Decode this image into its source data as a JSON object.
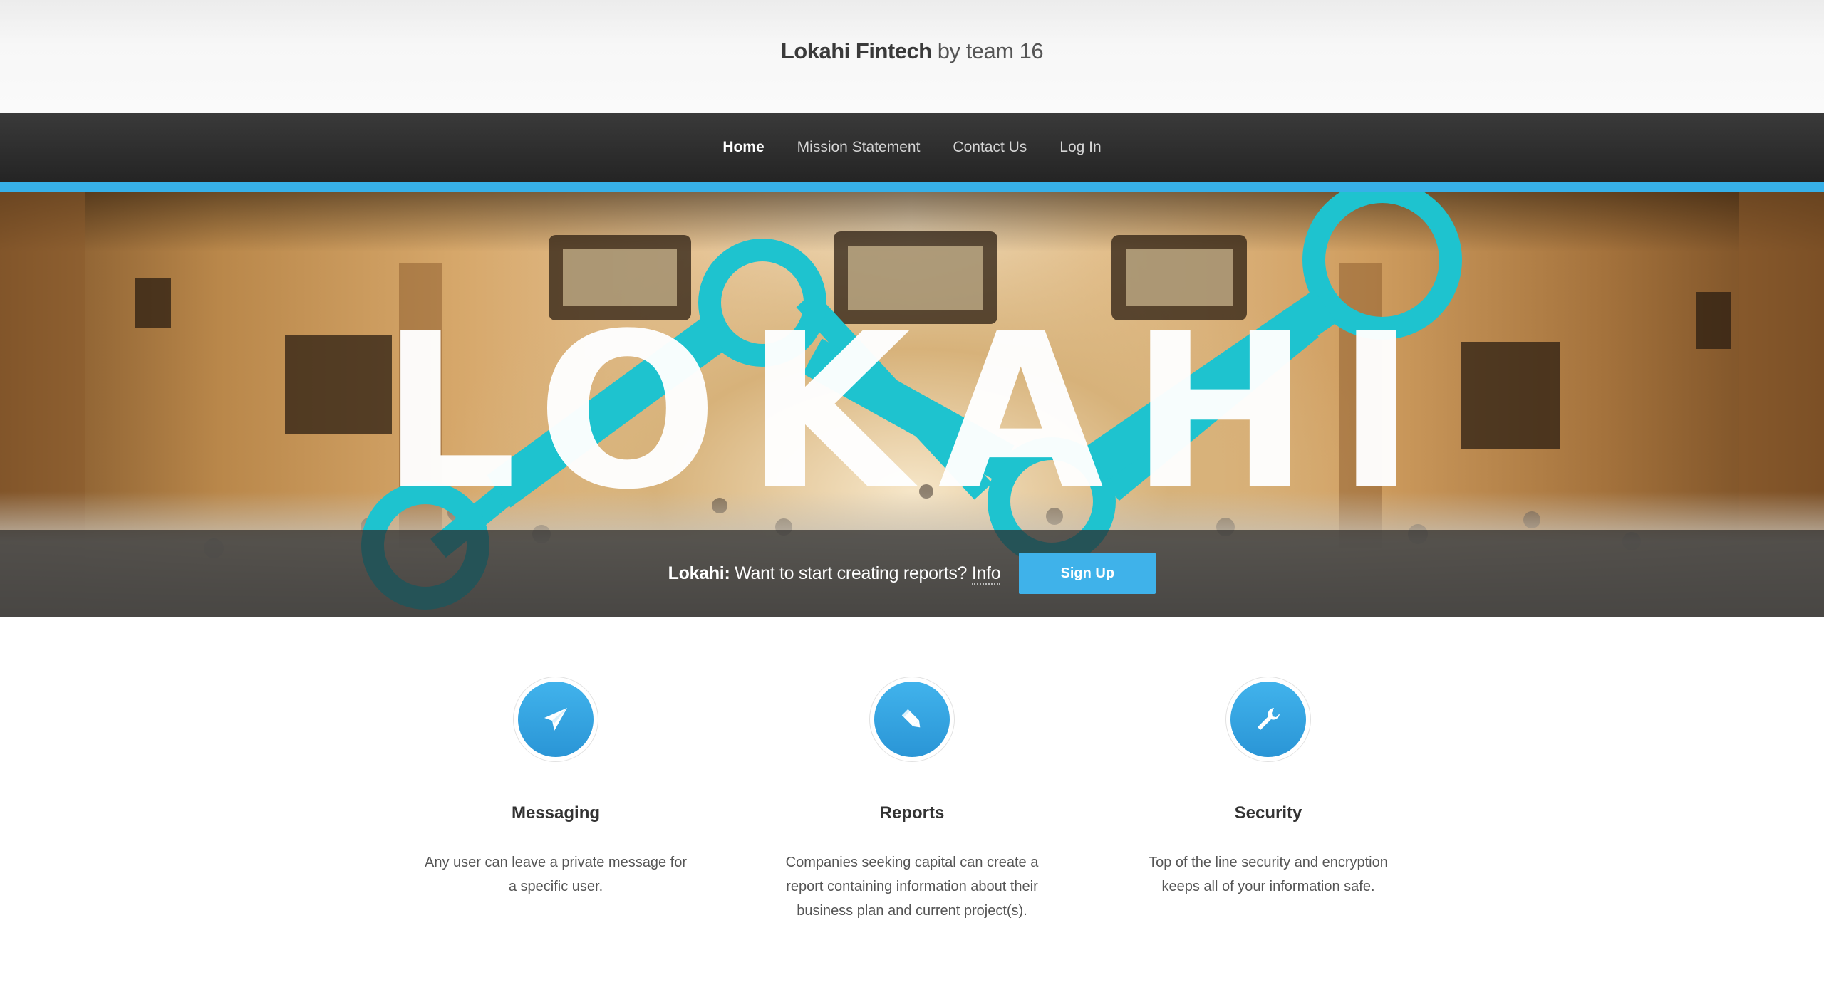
{
  "header": {
    "brand": "Lokahi Fintech",
    "byline": "by team 16"
  },
  "nav": {
    "items": [
      {
        "label": "Home",
        "active": true
      },
      {
        "label": "Mission Statement",
        "active": false
      },
      {
        "label": "Contact Us",
        "active": false
      },
      {
        "label": "Log In",
        "active": false
      }
    ]
  },
  "banner": {
    "logo_text": "LOKAHI",
    "cta_brand": "Lokahi:",
    "cta_text": "Want to start creating reports?",
    "cta_info": "Info",
    "signup_label": "Sign Up"
  },
  "features": [
    {
      "icon": "paper-plane-icon",
      "title": "Messaging",
      "desc": "Any user can leave a private message for a specific user."
    },
    {
      "icon": "pencil-icon",
      "title": "Reports",
      "desc": "Companies seeking capital can create a report containing information about their business plan and current project(s)."
    },
    {
      "icon": "wrench-icon",
      "title": "Security",
      "desc": "Top of the line security and encryption keeps all of your information safe."
    }
  ],
  "colors": {
    "accent": "#37b0e8",
    "logo_teal": "#1ec3cf",
    "nav_bg": "#2d2d2d"
  }
}
